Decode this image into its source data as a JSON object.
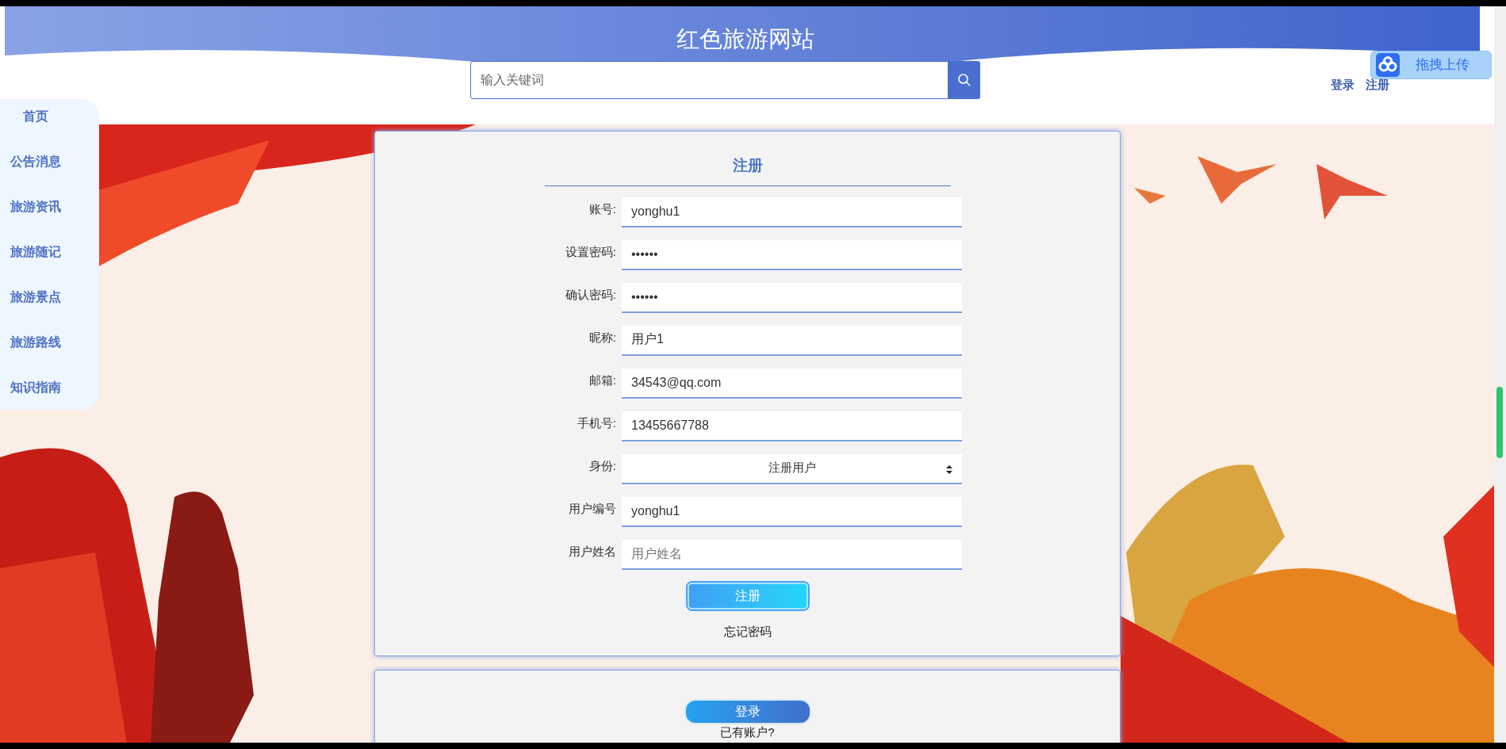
{
  "header": {
    "title": "红色旅游网站",
    "search": {
      "placeholder": "输入关键词"
    },
    "links": [
      "登录",
      "注册"
    ]
  },
  "upload_widget": {
    "label": "拖拽上传"
  },
  "sidebar": {
    "items": [
      {
        "label": "首页"
      },
      {
        "label": "公告消息"
      },
      {
        "label": "旅游资讯"
      },
      {
        "label": "旅游随记"
      },
      {
        "label": "旅游景点"
      },
      {
        "label": "旅游路线"
      },
      {
        "label": "知识指南"
      }
    ]
  },
  "register_form": {
    "title": "注册",
    "fields": [
      {
        "label": "账号:",
        "kind": "text",
        "value": "yonghu1"
      },
      {
        "label": "设置密码:",
        "kind": "password",
        "value": "••••••"
      },
      {
        "label": "确认密码:",
        "kind": "password",
        "value": "••••••"
      },
      {
        "label": "昵称:",
        "kind": "text",
        "value": "用户1"
      },
      {
        "label": "邮箱:",
        "kind": "text",
        "value": "34543@qq.com"
      },
      {
        "label": "手机号:",
        "kind": "text",
        "value": "13455667788"
      },
      {
        "label": "身份:",
        "kind": "select",
        "value": "注册用户"
      },
      {
        "label": "用户编号",
        "kind": "text",
        "value": "yonghu1"
      },
      {
        "label": "用户姓名",
        "kind": "text",
        "placeholder": "用户姓名"
      }
    ],
    "submit": "注册",
    "forgot_link": "忘记密码"
  },
  "login_card": {
    "button": "登录",
    "note": "已有账户?"
  }
}
